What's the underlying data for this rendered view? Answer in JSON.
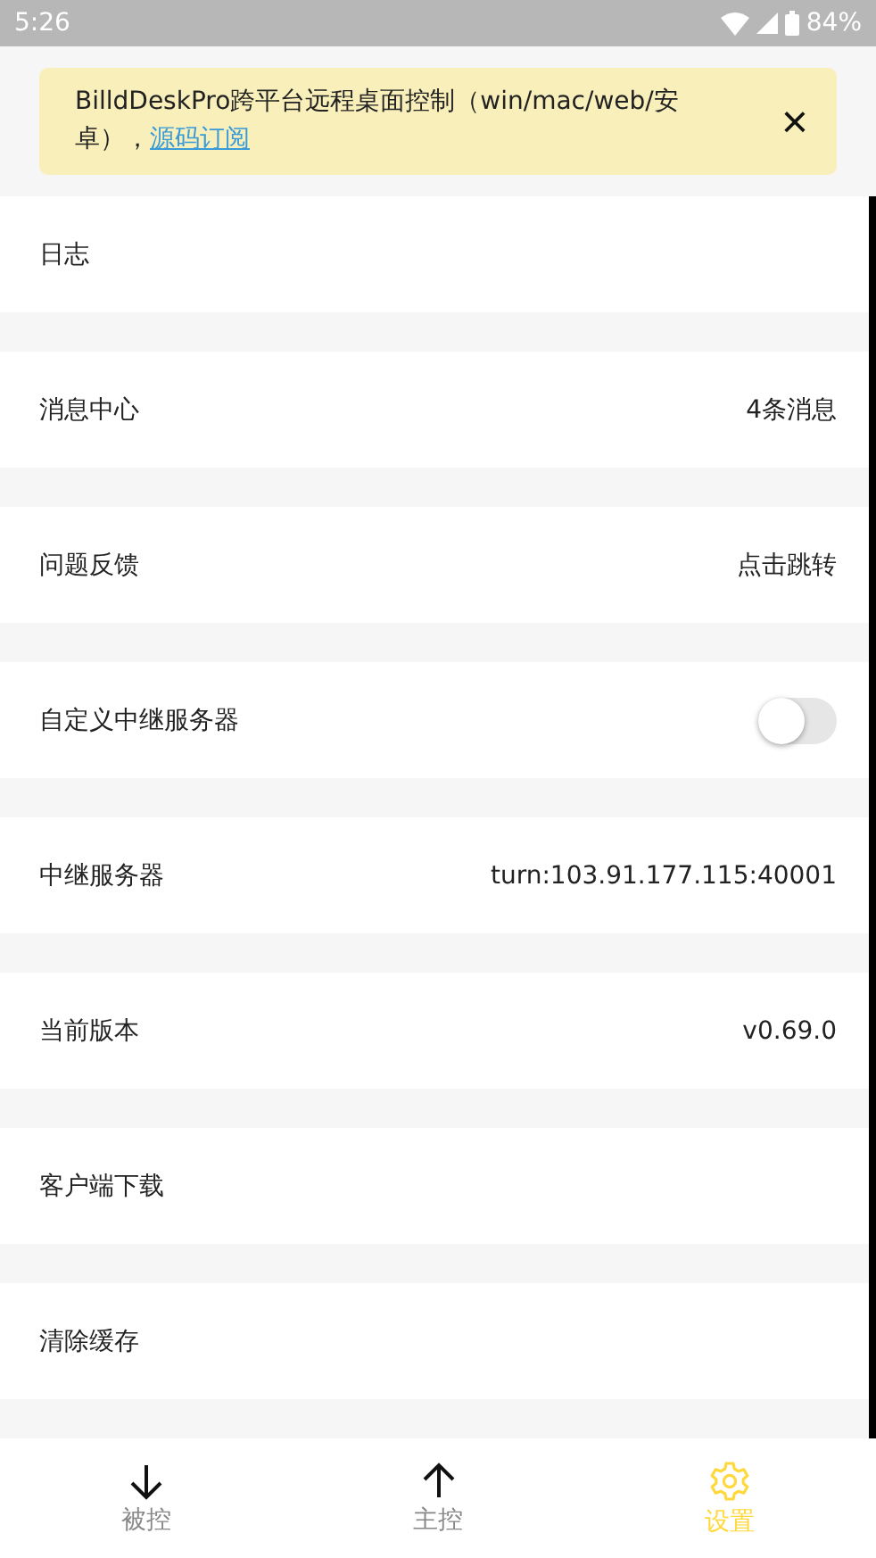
{
  "status_bar": {
    "time": "5:26",
    "battery": "84%"
  },
  "banner": {
    "text": "BilldDeskPro跨平台远程桌面控制（win/mac/web/安卓），",
    "link": "源码订阅",
    "close": "×"
  },
  "settings": [
    {
      "kind": "plain",
      "label": "日志"
    },
    {
      "kind": "value",
      "label": "消息中心",
      "value": "4条消息"
    },
    {
      "kind": "value",
      "label": "问题反馈",
      "value": "点击跳转"
    },
    {
      "kind": "toggle",
      "label": "自定义中继服务器",
      "on": false
    },
    {
      "kind": "value",
      "label": "中继服务器",
      "value": "turn:103.91.177.115:40001"
    },
    {
      "kind": "value",
      "label": "当前版本",
      "value": "v0.69.0"
    },
    {
      "kind": "plain",
      "label": "客户端下载"
    },
    {
      "kind": "plain",
      "label": "清除缓存"
    }
  ],
  "tabs": [
    {
      "label": "被控",
      "kind": "down",
      "selected": false
    },
    {
      "label": "主控",
      "kind": "up",
      "selected": false
    },
    {
      "label": "设置",
      "kind": "gear",
      "selected": true
    }
  ]
}
